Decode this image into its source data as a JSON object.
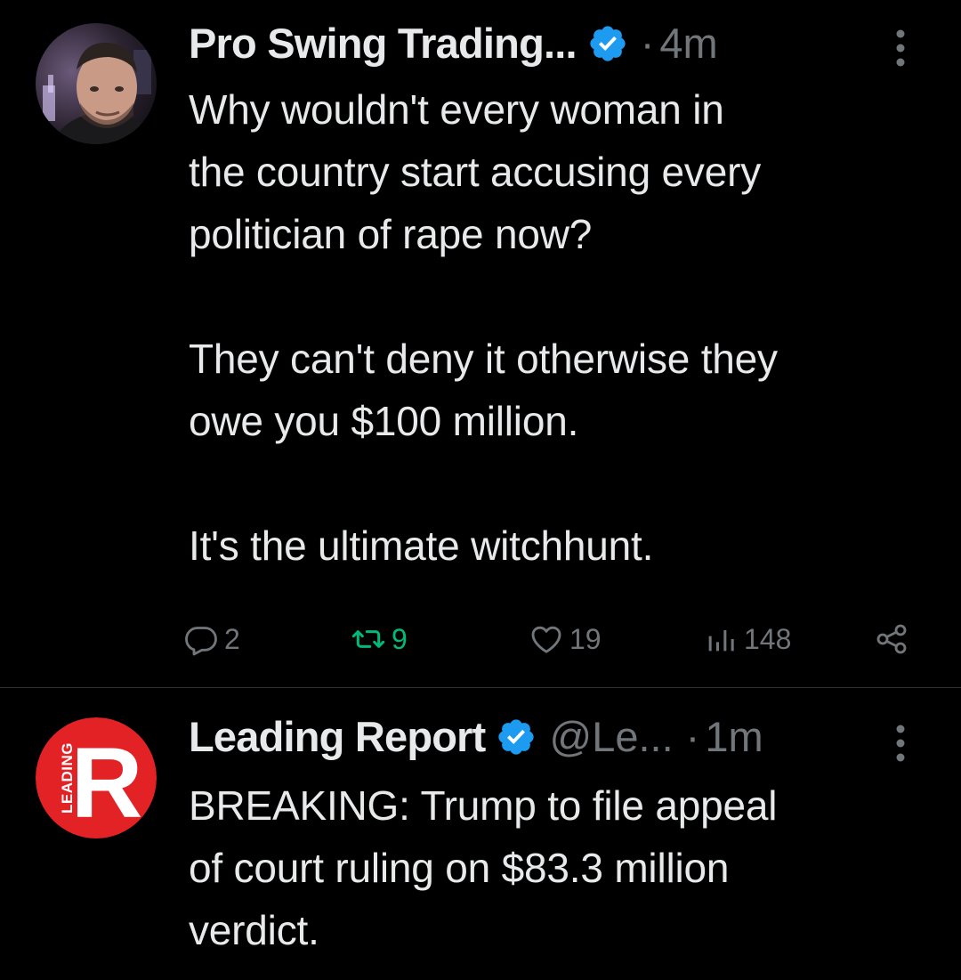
{
  "colors": {
    "background": "#000000",
    "text": "#e7e9ea",
    "muted": "#71767b",
    "verified": "#1d9bf0",
    "retweeted": "#00ba7c",
    "divider": "#2f3336",
    "brand_red": "#e32226"
  },
  "tweets": [
    {
      "author_name": "Pro Swing Trading...",
      "handle": "",
      "separator": "·",
      "time": "4m",
      "verified_icon": "verified-badge-icon",
      "body": "Why wouldn't every woman in\nthe country start accusing every\npolitician of rape now?\n\nThey can't deny it otherwise they\nowe you $100 million.\n\nIt's the ultimate witchhunt.",
      "actions": {
        "reply_count": "2",
        "retweet_count": "9",
        "like_count": "19",
        "views_count": "148"
      }
    },
    {
      "author_name": "Leading Report",
      "handle": "@Le...",
      "separator": "·",
      "time": "1m",
      "verified_icon": "verified-badge-icon",
      "avatar_logo_letter": "R",
      "avatar_logo_text": "LEADING",
      "body": "BREAKING: Trump to file appeal\nof court ruling on $83.3 million\nverdict."
    }
  ]
}
